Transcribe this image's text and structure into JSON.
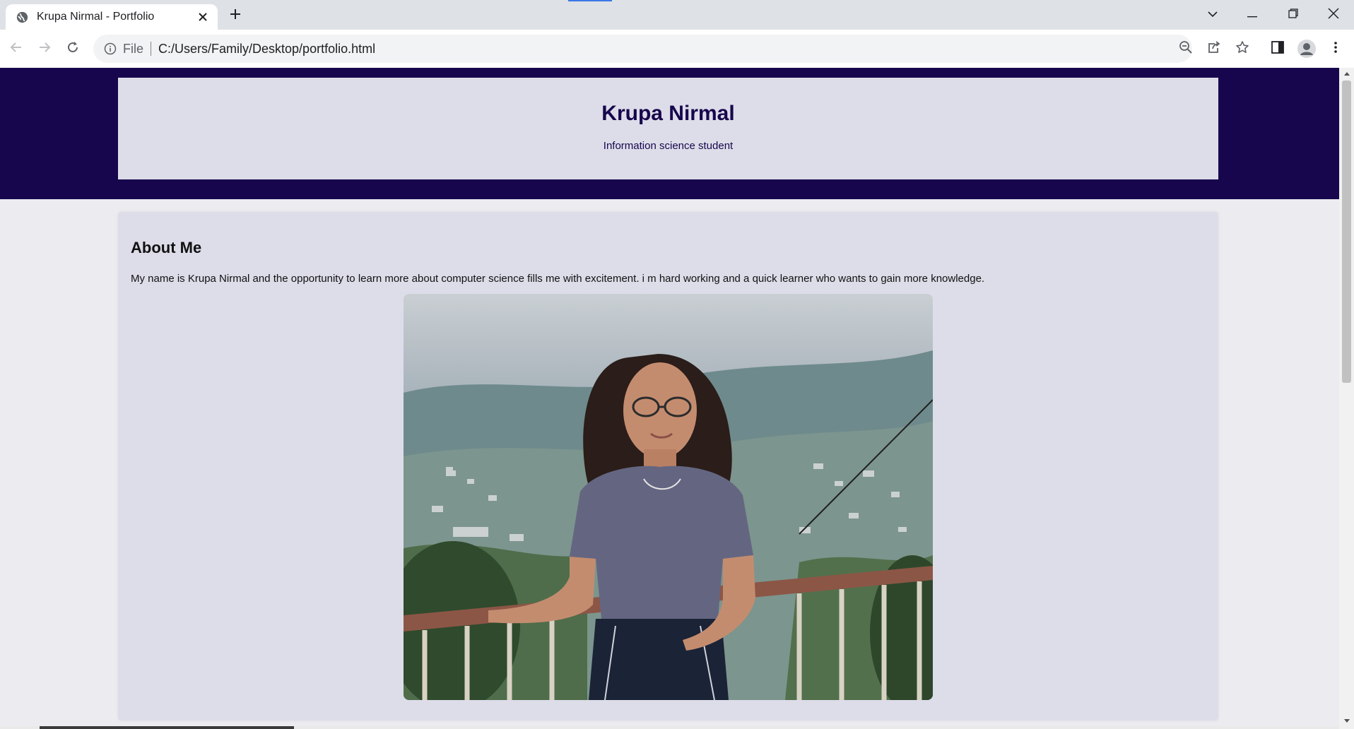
{
  "browser": {
    "tab": {
      "title": "Krupa Nirmal - Portfolio",
      "favicon": "globe-icon",
      "close_icon": "close-icon"
    },
    "new_tab_icon": "plus-icon",
    "window_controls": [
      "chevron-down-icon",
      "minimize-icon",
      "restore-icon",
      "close-icon"
    ],
    "toolbar": {
      "back_icon": "arrow-left-icon",
      "forward_icon": "arrow-right-icon",
      "reload_icon": "reload-icon",
      "site_info_icon": "info-icon",
      "scheme": "File",
      "url": "C:/Users/Family/Desktop/portfolio.html",
      "right_icons": [
        "zoom-out-icon",
        "share-icon",
        "star-icon",
        "side-panel-icon",
        "profile-icon",
        "kebab-menu-icon"
      ]
    },
    "colors": {
      "tab_strip": "#dee1e6",
      "omnibox": "#f1f3f4",
      "loading_indicator": "#3b78e7"
    }
  },
  "page": {
    "header": {
      "name": "Krupa Nirmal",
      "subtitle": "Information science student"
    },
    "about": {
      "heading": "About Me",
      "bio": "My name is Krupa Nirmal and the opportunity to learn more about computer science fills me with excitement. i m hard working and a quick learner who wants to gain more knowledge.",
      "photo": "portrait-photo"
    },
    "colors": {
      "header_band": "#17064d",
      "card_background": "#dddde9",
      "page_background": "#ececf0",
      "heading_text": "#17064d"
    }
  }
}
